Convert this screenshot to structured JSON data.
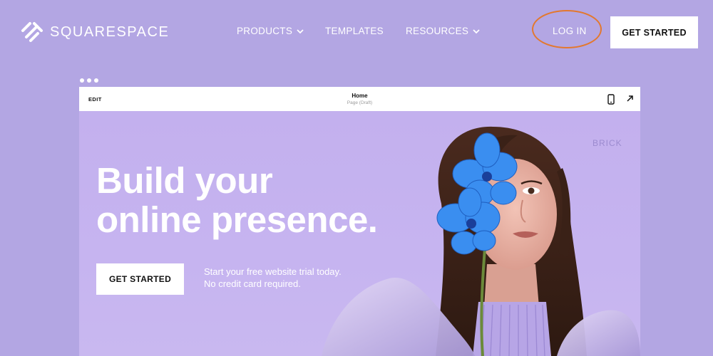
{
  "nav": {
    "logo_text": "SQUARESPACE",
    "items": [
      {
        "label": "PRODUCTS",
        "has_dropdown": true
      },
      {
        "label": "TEMPLATES",
        "has_dropdown": false
      },
      {
        "label": "RESOURCES",
        "has_dropdown": true
      }
    ],
    "login_label": "LOG IN",
    "cta_label": "GET STARTED"
  },
  "editor": {
    "edit_label": "EDIT",
    "page_title": "Home",
    "page_subtitle": "Page (Draft)"
  },
  "hero": {
    "brand_mark": "BRICK",
    "headline_line1": "Build your",
    "headline_line2": "online presence.",
    "cta_label": "GET STARTED",
    "trial_line1": "Start your free website trial today.",
    "trial_line2": "No credit card required."
  },
  "colors": {
    "page_background": "#b3a6e3",
    "hero_background": "#c6b4f0",
    "login_highlight": "#e3782e",
    "orchid": "#3a8ef0"
  },
  "icons": [
    "squarespace-logo-icon",
    "chevron-down-icon",
    "mobile-preview-icon",
    "external-link-arrow-icon"
  ]
}
